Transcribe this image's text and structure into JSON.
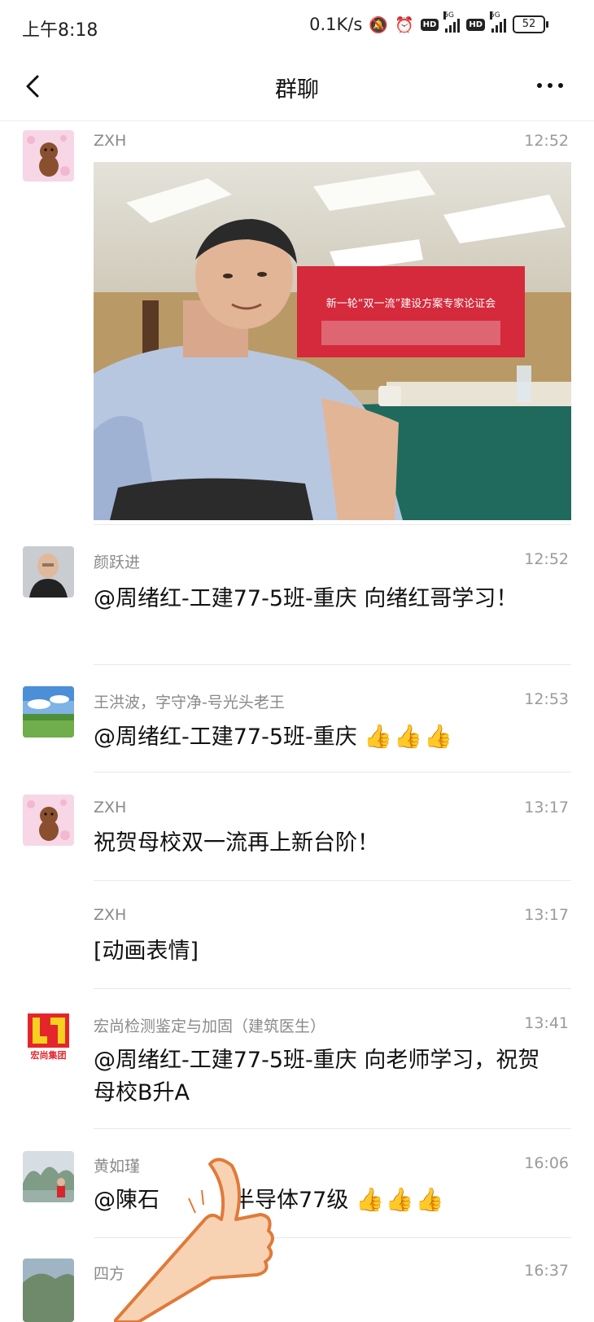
{
  "status_bar": {
    "time": "上午8:18",
    "net_speed": "0.1K/s",
    "hd1": "HD",
    "hd2": "HD",
    "net1": "5G",
    "net2": "5G",
    "battery": "52"
  },
  "header": {
    "title": "群聊"
  },
  "messages": [
    {
      "sender": "ZXH",
      "time": "12:52"
    },
    {
      "sender": "颜跃进",
      "time": "12:52",
      "text": "@周绪红-工建77-5班-重庆 向绪红哥学习！"
    },
    {
      "sender": "王洪波，字守净-号光头老王",
      "time": "12:53",
      "text": "@周绪红-工建77-5班-重庆",
      "emoji": "👍👍👍"
    },
    {
      "sender": "ZXH",
      "time": "13:17",
      "text": "祝贺母校双一流再上新台阶！"
    },
    {
      "sender": "ZXH",
      "time": "13:17",
      "text": "[动画表情]"
    },
    {
      "sender": "宏尚检测鉴定与加固（建筑医生）",
      "time": "13:41",
      "text": "@周绪红-工建77-5班-重庆 向老师学习，祝贺母校B升A"
    },
    {
      "sender": "黄如瑾",
      "time": "16:06",
      "text": "@陳石",
      "text_tail": "半导体77级",
      "emoji": "👍👍👍"
    },
    {
      "sender": "四方",
      "time": "16:37"
    }
  ],
  "photo": {
    "banner_text": "新一轮“双一流”建设方案专家论证会"
  },
  "avatars": {
    "hongshang_label": "宏尚集团"
  },
  "colors": {
    "name_gray": "#8a8a8a",
    "divider": "#e9e9e9",
    "banner_red": "#d42a3c",
    "table_green": "#1f6a5c"
  }
}
